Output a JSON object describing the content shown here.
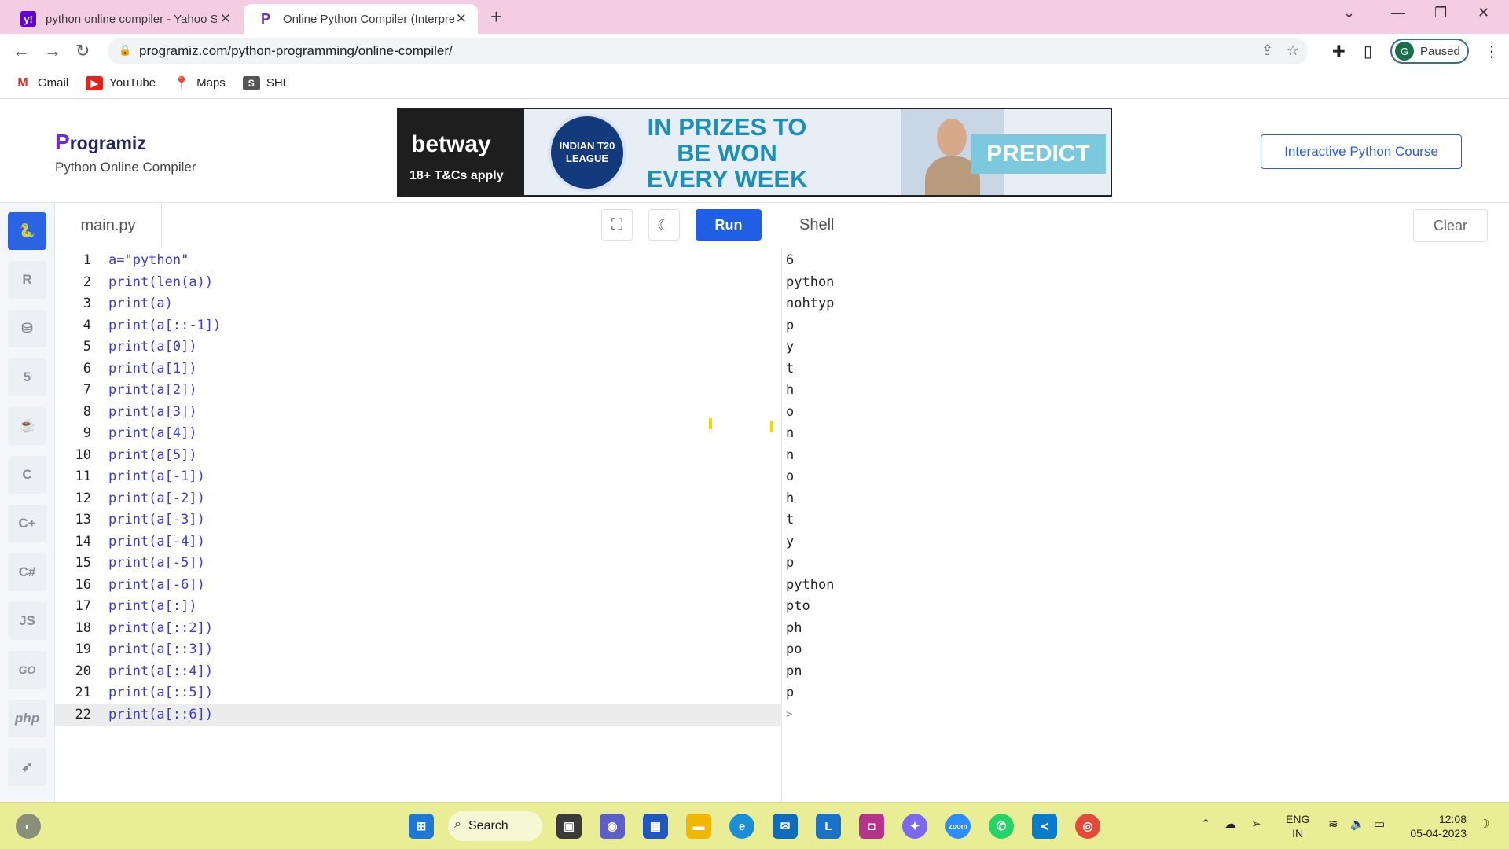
{
  "browser": {
    "tabs": [
      {
        "title": "python online compiler - Yahoo S",
        "favicon": "yahoo-icon",
        "active": false
      },
      {
        "title": "Online Python Compiler (Interpre",
        "favicon": "programiz-icon",
        "active": true
      }
    ],
    "url": "programiz.com/python-programming/online-compiler/",
    "profile_initial": "G",
    "profile_status": "Paused",
    "bookmarks": [
      {
        "label": "Gmail",
        "icon": "gmail-icon"
      },
      {
        "label": "YouTube",
        "icon": "youtube-icon"
      },
      {
        "label": "Maps",
        "icon": "maps-icon"
      },
      {
        "label": "SHL",
        "icon": "shl-icon"
      }
    ]
  },
  "site": {
    "logo_text": "rogramiz",
    "subtitle": "Python Online Compiler",
    "course_button": "Interactive Python Course",
    "ad": {
      "brand": "betway",
      "terms": "18+ T&Cs apply",
      "badge": "INDIAN T20 LEAGUE",
      "headline": "IN PRIZES TO BE WON EVERY WEEK",
      "cta": "PREDICT"
    }
  },
  "sidebar": {
    "languages": [
      "python",
      "r",
      "sql",
      "html",
      "java",
      "c",
      "c++",
      "c#",
      "JS",
      "GO",
      "php",
      "swift"
    ]
  },
  "editor": {
    "filename": "main.py",
    "run_label": "Run",
    "current_line": 22,
    "lines": [
      "a=\"python\"",
      "print(len(a))",
      "print(a)",
      "print(a[::-1])",
      "print(a[0])",
      "print(a[1])",
      "print(a[2])",
      "print(a[3])",
      "print(a[4])",
      "print(a[5])",
      "print(a[-1])",
      "print(a[-2])",
      "print(a[-3])",
      "print(a[-4])",
      "print(a[-5])",
      "print(a[-6])",
      "print(a[:])",
      "print(a[::2])",
      "print(a[::3])",
      "print(a[::4])",
      "print(a[::5])",
      "print(a[::6])"
    ]
  },
  "shell": {
    "title": "Shell",
    "clear_label": "Clear",
    "output": [
      "6",
      "python",
      "nohtyp",
      "p",
      "y",
      "t",
      "h",
      "o",
      "n",
      "n",
      "o",
      "h",
      "t",
      "y",
      "p",
      "python",
      "pto",
      "ph",
      "po",
      "pn",
      "p",
      ">"
    ]
  },
  "taskbar": {
    "search_label": "Search",
    "language": "ENG",
    "region": "IN",
    "time": "12:08",
    "date": "05-04-2023"
  },
  "colors": {
    "tabbar": "#f4cde3",
    "accent": "#1f5fe4",
    "taskbar": "#e9ee96"
  }
}
